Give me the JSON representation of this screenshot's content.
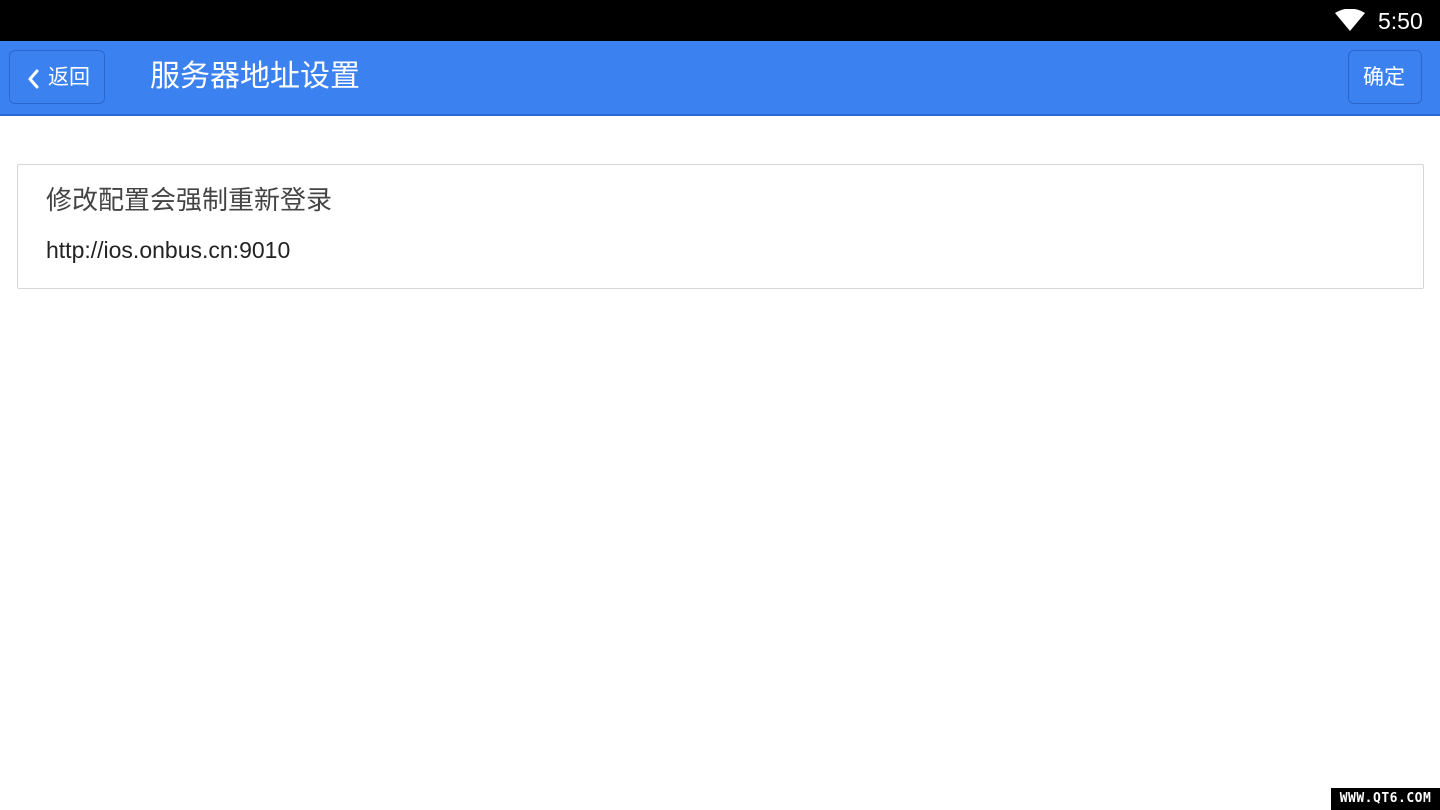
{
  "status_bar": {
    "time": "5:50",
    "wifi_icon": "wifi-icon"
  },
  "header": {
    "back_label": "返回",
    "back_icon": "chevron-left-icon",
    "title": "服务器地址设置",
    "confirm_label": "确定",
    "background_color": "#3b82f0"
  },
  "main": {
    "note": "修改配置会强制重新登录",
    "server_url": "http://ios.onbus.cn:9010"
  },
  "watermark": {
    "text": "WWW.QT6.COM"
  }
}
